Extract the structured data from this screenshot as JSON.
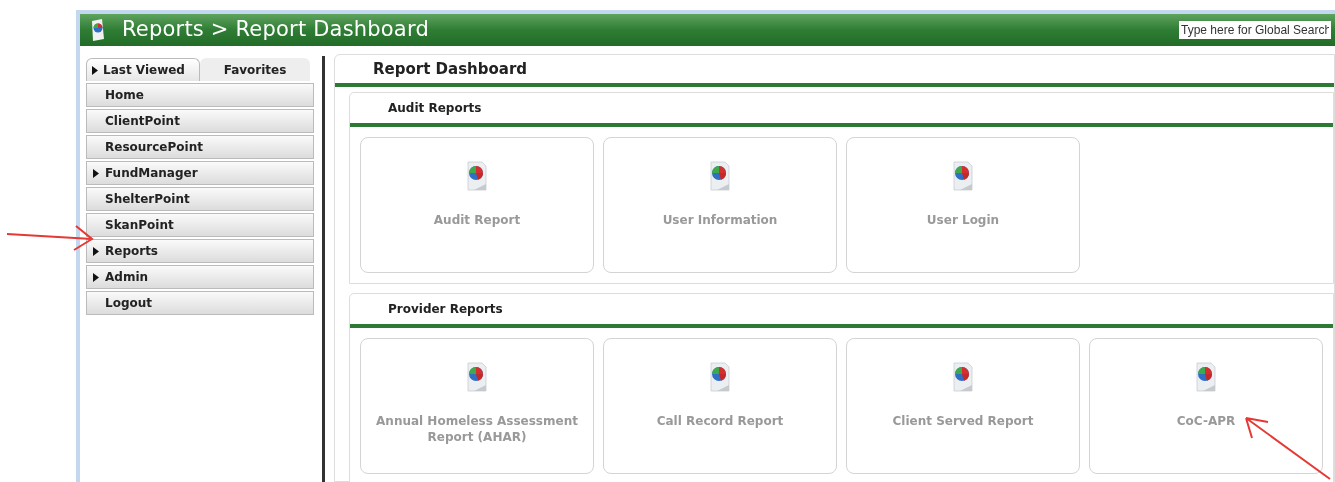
{
  "window": {
    "title": "Reports > Report Dashboard"
  },
  "global_search": {
    "placeholder": "Type here for Global Search"
  },
  "sidebar": {
    "tabs": [
      {
        "label": "Last Viewed",
        "selected": true,
        "expandable": true
      },
      {
        "label": "Favorites",
        "selected": false,
        "expandable": false
      }
    ],
    "items": [
      {
        "label": "Home",
        "expandable": false
      },
      {
        "label": "ClientPoint",
        "expandable": false
      },
      {
        "label": "ResourcePoint",
        "expandable": false
      },
      {
        "label": "FundManager",
        "expandable": true
      },
      {
        "label": "ShelterPoint",
        "expandable": false
      },
      {
        "label": "SkanPoint",
        "expandable": false
      },
      {
        "label": "Reports",
        "expandable": true
      },
      {
        "label": "Admin",
        "expandable": true
      },
      {
        "label": "Logout",
        "expandable": false
      }
    ]
  },
  "main": {
    "title": "Report Dashboard",
    "sections": [
      {
        "title": "Audit Reports",
        "reports": [
          "Audit Report",
          "User Information",
          "User Login"
        ]
      },
      {
        "title": "Provider Reports",
        "reports": [
          "Annual Homeless Assessment Report (AHAR)",
          "Call Record Report",
          "Client Served Report",
          "CoC-APR"
        ]
      }
    ]
  }
}
